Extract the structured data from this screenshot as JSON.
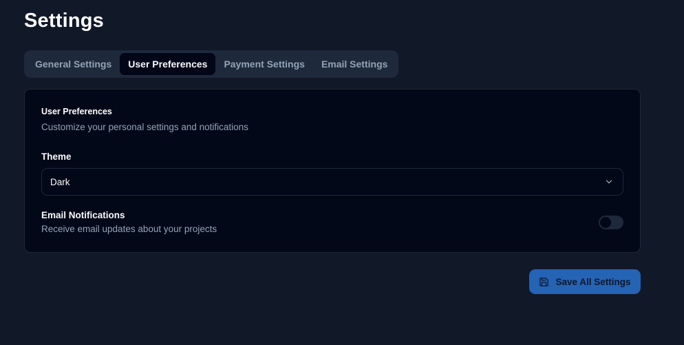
{
  "page": {
    "title": "Settings"
  },
  "tabs": [
    {
      "label": "General Settings",
      "active": false
    },
    {
      "label": "User Preferences",
      "active": true
    },
    {
      "label": "Payment Settings",
      "active": false
    },
    {
      "label": "Email Settings",
      "active": false
    }
  ],
  "card": {
    "title": "User Preferences",
    "description": "Customize your personal settings and notifications",
    "theme": {
      "label": "Theme",
      "selected": "Dark",
      "icon": "chevron-down-icon"
    },
    "email_notifications": {
      "label": "Email Notifications",
      "description": "Receive email updates about your projects",
      "enabled": false
    }
  },
  "actions": {
    "save_label": "Save All Settings",
    "save_icon": "save-icon"
  },
  "colors": {
    "background": "#111827",
    "card": "#020817",
    "tabs_bg": "#1e293b",
    "accent": "#2563b5",
    "muted_text": "#94a3b8"
  }
}
